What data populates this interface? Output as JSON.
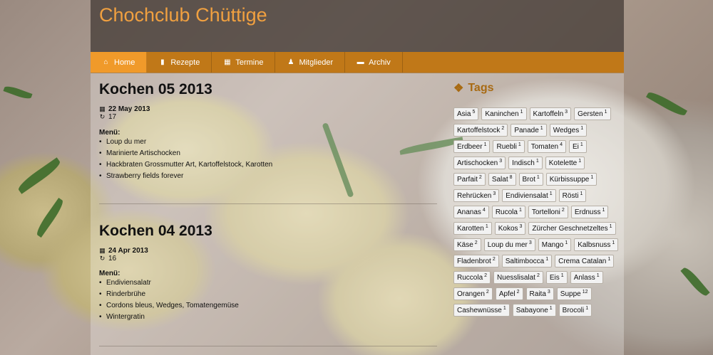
{
  "site": {
    "title": "Chochclub Chüttige"
  },
  "nav": [
    {
      "label": "Home",
      "icon": "home-icon",
      "active": true
    },
    {
      "label": "Rezepte",
      "icon": "book-icon"
    },
    {
      "label": "Termine",
      "icon": "calendar-icon"
    },
    {
      "label": "Mitglieder",
      "icon": "user-icon"
    },
    {
      "label": "Archiv",
      "icon": "folder-icon"
    }
  ],
  "posts": [
    {
      "title": "Kochen 05 2013",
      "date": "22 May 2013",
      "count": "17",
      "menu_label": "Menü:",
      "items": [
        "Loup du mer",
        "Marinierte Artischocken",
        "Hackbraten Grossmutter Art, Kartoffelstock, Karotten",
        "Strawberry fields forever"
      ]
    },
    {
      "title": "Kochen 04 2013",
      "date": "24 Apr 2013",
      "count": "16",
      "menu_label": "Menü:",
      "items": [
        "Endiviensalatr",
        "Rinderbrühe",
        "Cordons bleus, Wedges, Tomatengemüse",
        "Wintergratin"
      ]
    }
  ],
  "sidebar": {
    "tags_title": "Tags",
    "tags": [
      {
        "name": "Asia",
        "count": "5"
      },
      {
        "name": "Kaninchen",
        "count": "1"
      },
      {
        "name": "Kartoffeln",
        "count": "3"
      },
      {
        "name": "Gersten",
        "count": "1"
      },
      {
        "name": "Kartoffelstock",
        "count": "2"
      },
      {
        "name": "Panade",
        "count": "1"
      },
      {
        "name": "Wedges",
        "count": "1"
      },
      {
        "name": "Erdbeer",
        "count": "1"
      },
      {
        "name": "Ruebli",
        "count": "1"
      },
      {
        "name": "Tomaten",
        "count": "4"
      },
      {
        "name": "Ei",
        "count": "1"
      },
      {
        "name": "Artischocken",
        "count": "3"
      },
      {
        "name": "Indisch",
        "count": "1"
      },
      {
        "name": "Kotelette",
        "count": "1"
      },
      {
        "name": "Parfait",
        "count": "2"
      },
      {
        "name": "Salat",
        "count": "8"
      },
      {
        "name": "Brot",
        "count": "1"
      },
      {
        "name": "Kürbissuppe",
        "count": "1"
      },
      {
        "name": "Rehrücken",
        "count": "3"
      },
      {
        "name": "Endiviensalat",
        "count": "1"
      },
      {
        "name": "Rösti",
        "count": "1"
      },
      {
        "name": "Ananas",
        "count": "4"
      },
      {
        "name": "Rucola",
        "count": "1"
      },
      {
        "name": "Tortelloni",
        "count": "2"
      },
      {
        "name": "Erdnuss",
        "count": "1"
      },
      {
        "name": "Karotten",
        "count": "1"
      },
      {
        "name": "Kokos",
        "count": "3"
      },
      {
        "name": "Zürcher Geschnetzeltes",
        "count": "1"
      },
      {
        "name": "Käse",
        "count": "2"
      },
      {
        "name": "Loup du mer",
        "count": "3"
      },
      {
        "name": "Mango",
        "count": "1"
      },
      {
        "name": "Kalbsnuss",
        "count": "1"
      },
      {
        "name": "Fladenbrot",
        "count": "2"
      },
      {
        "name": "Saltimbocca",
        "count": "1"
      },
      {
        "name": "Crema Catalan",
        "count": "1"
      },
      {
        "name": "Ruccola",
        "count": "2"
      },
      {
        "name": "Nuesslisalat",
        "count": "2"
      },
      {
        "name": "Eis",
        "count": "1"
      },
      {
        "name": "Anlass",
        "count": "1"
      },
      {
        "name": "Orangen",
        "count": "2"
      },
      {
        "name": "Apfel",
        "count": "2"
      },
      {
        "name": "Raita",
        "count": "3"
      },
      {
        "name": "Suppe",
        "count": "12"
      },
      {
        "name": "Cashewnüsse",
        "count": "1"
      },
      {
        "name": "Sabayone",
        "count": "1"
      },
      {
        "name": "Brocoli",
        "count": "1"
      }
    ]
  }
}
